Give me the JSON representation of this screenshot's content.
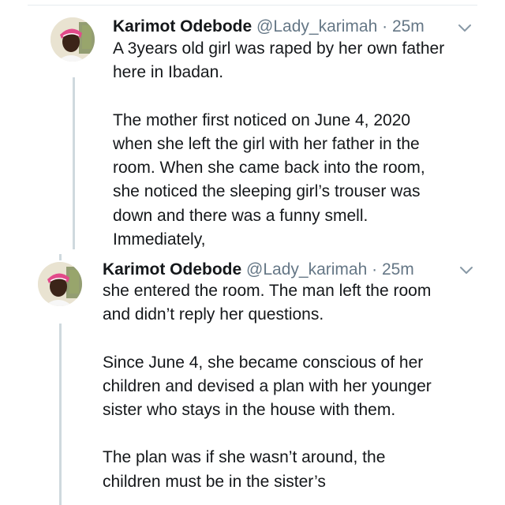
{
  "tweets": [
    {
      "author_name": "Karimot Odebode",
      "handle": "@Lady_karimah",
      "separator": "·",
      "time": "25m",
      "paragraphs": [
        [
          "A 3years old girl was raped by her own father",
          "here in Ibadan."
        ],
        [
          "The mother first noticed on June 4, 2020",
          "when she left the girl with her father in the",
          "room. When she came back into the room,",
          "she noticed the sleeping girl’s trouser was",
          "down and there was a funny smell.",
          "Immediately,"
        ]
      ]
    },
    {
      "author_name": "Karimot Odebode",
      "handle": "@Lady_karimah",
      "separator": "·",
      "time": "25m",
      "paragraphs": [
        [
          "she entered the room. The man left the room",
          "and didn’t reply her questions."
        ],
        [
          "Since June 4, she became conscious of her",
          "children and devised a plan with her younger",
          "sister who stays in the house with them."
        ],
        [
          "The plan was if she wasn’t around, the",
          "children must be in the sister’s"
        ]
      ]
    }
  ],
  "icons": {
    "caret": "chevron-down-icon",
    "avatar": "profile-photo"
  },
  "colors": {
    "text": "#14171a",
    "secondary": "#657786",
    "thread_line": "#cfd9de",
    "headwrap": "#e24a8a"
  }
}
